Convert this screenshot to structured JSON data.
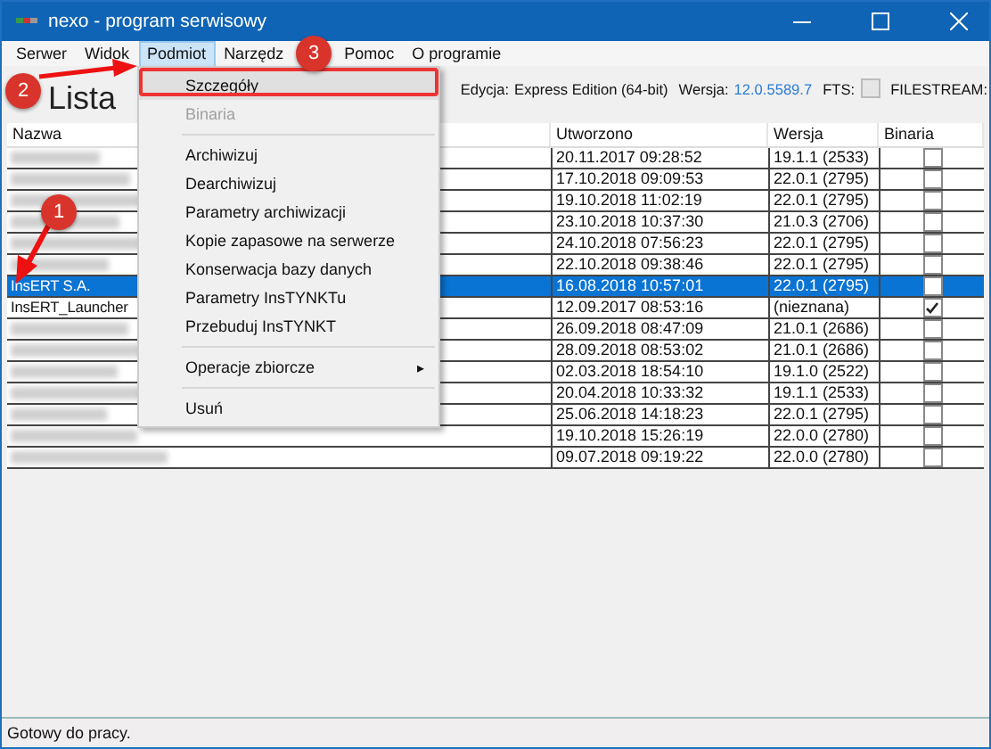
{
  "window": {
    "title": "nexo - program serwisowy"
  },
  "menu_bar": [
    {
      "label": "Serwer",
      "selected": false
    },
    {
      "label": "Widok",
      "selected": false
    },
    {
      "label": "Podmiot",
      "selected": true
    },
    {
      "label": "Narzędz",
      "selected": false
    },
    {
      "label": "Pomoc",
      "selected": false
    },
    {
      "label": "O programie",
      "selected": false
    }
  ],
  "heading": "Lista",
  "server_info": {
    "edition_label": "Edycja:",
    "edition": "Express Edition (64-bit)",
    "version_label": "Wersja:",
    "version": "12.0.5589.7",
    "fts_label": "FTS:",
    "fts_checked": false,
    "filestream_label": "FILESTREAM:"
  },
  "dropdown": [
    {
      "kind": "item",
      "label": "Szczegóły",
      "disabled": false,
      "selected": true
    },
    {
      "kind": "item",
      "label": "Binaria",
      "disabled": true,
      "selected": false
    },
    {
      "kind": "separator"
    },
    {
      "kind": "item",
      "label": "Archiwizuj",
      "disabled": false,
      "selected": false
    },
    {
      "kind": "item",
      "label": "Dearchiwizuj",
      "disabled": false,
      "selected": false
    },
    {
      "kind": "item",
      "label": "Parametry archiwizacji",
      "disabled": false,
      "selected": false
    },
    {
      "kind": "item",
      "label": "Kopie zapasowe na serwerze",
      "disabled": false,
      "selected": false
    },
    {
      "kind": "item",
      "label": "Konserwacja bazy danych",
      "disabled": false,
      "selected": false
    },
    {
      "kind": "item",
      "label": "Parametry InsTYNKTu",
      "disabled": false,
      "selected": false
    },
    {
      "kind": "item",
      "label": "Przebuduj InsTYNKT",
      "disabled": false,
      "selected": false
    },
    {
      "kind": "separator"
    },
    {
      "kind": "submenu",
      "label": "Operacje zbiorcze",
      "arrow": "▸",
      "disabled": false,
      "selected": false
    },
    {
      "kind": "separator"
    },
    {
      "kind": "item",
      "label": "Usuń",
      "disabled": false,
      "selected": false
    }
  ],
  "table": {
    "columns": [
      "Nazwa",
      "Utworzono",
      "Wersja",
      "Binaria"
    ],
    "rows": [
      {
        "blurred": true,
        "created": "20.11.2017 09:28:52",
        "version": "19.1.1 (2533)",
        "binaries": false,
        "selected": false
      },
      {
        "blurred": true,
        "created": "17.10.2018 09:09:53",
        "version": "22.0.1 (2795)",
        "binaries": false,
        "selected": false
      },
      {
        "blurred": true,
        "created": "19.10.2018 11:02:19",
        "version": "22.0.1 (2795)",
        "binaries": false,
        "selected": false
      },
      {
        "blurred": true,
        "created": "23.10.2018 10:37:30",
        "version": "21.0.3 (2706)",
        "binaries": false,
        "selected": false
      },
      {
        "blurred": true,
        "created": "24.10.2018 07:56:23",
        "version": "22.0.1 (2795)",
        "binaries": false,
        "selected": false
      },
      {
        "blurred": true,
        "created": "22.10.2018 09:38:46",
        "version": "22.0.1 (2795)",
        "binaries": false,
        "selected": false
      },
      {
        "name": "InsERT S.A.",
        "blurred": false,
        "created": "16.08.2018 10:57:01",
        "version": "22.0.1 (2795)",
        "binaries": false,
        "selected": true
      },
      {
        "name": "InsERT_Launcher",
        "blurred": false,
        "created": "12.09.2017 08:53:16",
        "version": "(nieznana)",
        "binaries": true,
        "selected": false
      },
      {
        "blurred": true,
        "created": "26.09.2018 08:47:09",
        "version": "21.0.1 (2686)",
        "binaries": false,
        "selected": false
      },
      {
        "blurred": true,
        "created": "28.09.2018 08:53:02",
        "version": "21.0.1 (2686)",
        "binaries": false,
        "selected": false
      },
      {
        "blurred": true,
        "created": "02.03.2018 18:54:10",
        "version": "19.1.0 (2522)",
        "binaries": false,
        "selected": false
      },
      {
        "blurred": true,
        "created": "20.04.2018 10:33:32",
        "version": "19.1.1 (2533)",
        "binaries": false,
        "selected": false
      },
      {
        "blurred": true,
        "created": "25.06.2018 14:18:23",
        "version": "22.0.1 (2795)",
        "binaries": false,
        "selected": false
      },
      {
        "blurred": true,
        "created": "19.10.2018 15:26:19",
        "version": "22.0.0 (2780)",
        "binaries": false,
        "selected": false
      },
      {
        "blurred": true,
        "created": "09.07.2018 09:19:22",
        "version": "22.0.0 (2780)",
        "binaries": false,
        "selected": false
      }
    ]
  },
  "annotations": [
    {
      "number": "1"
    },
    {
      "number": "2"
    },
    {
      "number": "3"
    }
  ],
  "status_bar": "Gotowy do pracy."
}
